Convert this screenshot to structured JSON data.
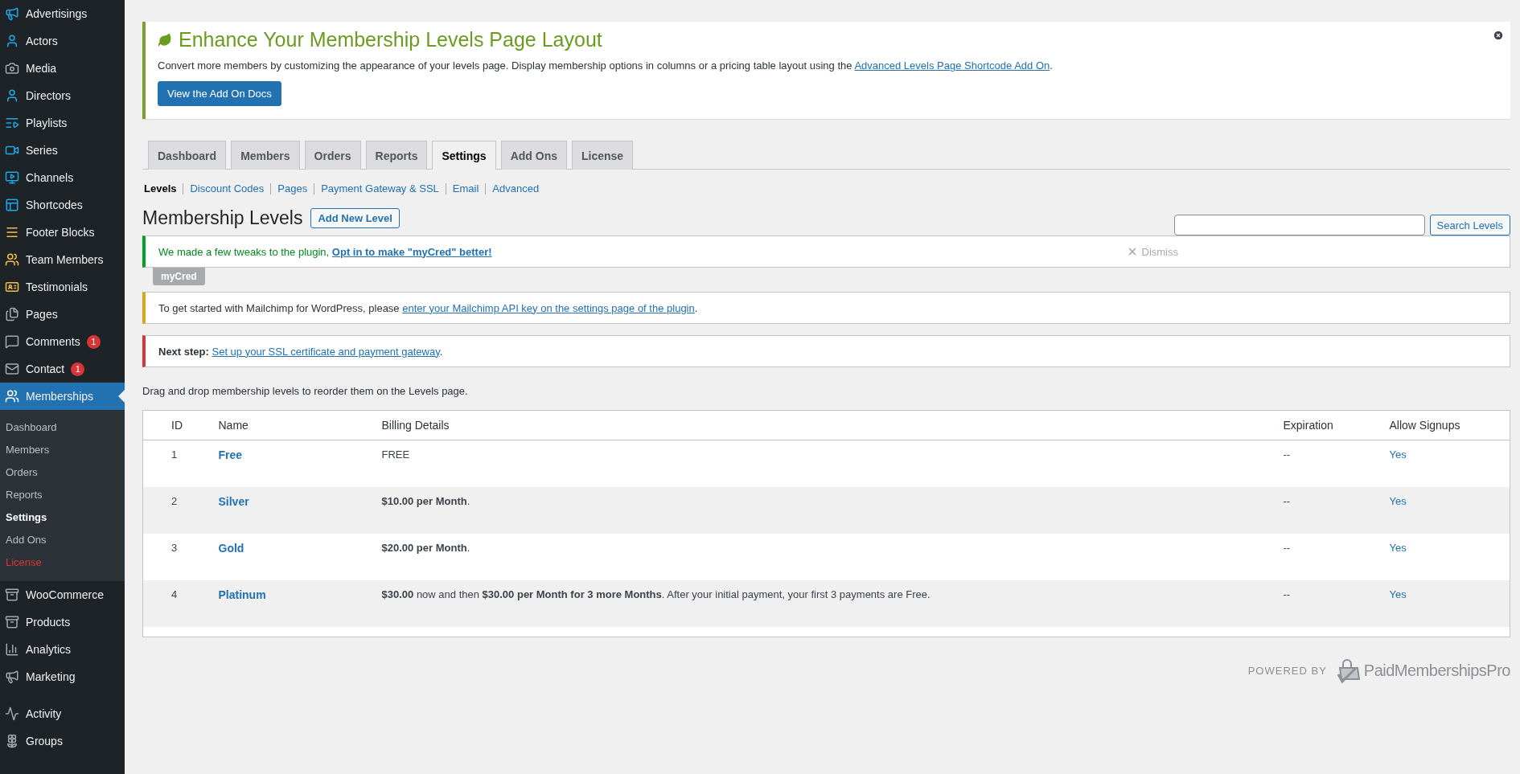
{
  "sidebar": {
    "sections": [
      {
        "items": [
          {
            "label": "Advertisings",
            "selected": false
          },
          {
            "label": "Actors",
            "selected": false
          },
          {
            "label": "Media",
            "selected": false
          },
          {
            "label": "Directors",
            "selected": false
          },
          {
            "label": "Playlists",
            "selected": false
          },
          {
            "label": "Series",
            "selected": false
          },
          {
            "label": "Channels",
            "selected": false
          },
          {
            "label": "Shortcodes",
            "selected": false
          },
          {
            "label": "Footer Blocks",
            "selected": false
          },
          {
            "label": "Team Members",
            "selected": false
          },
          {
            "label": "Testimonials",
            "selected": false
          },
          {
            "label": "Pages",
            "selected": false
          },
          {
            "label": "Comments",
            "selected": false,
            "badge": "1"
          },
          {
            "label": "Contact",
            "selected": false,
            "badge": "1"
          },
          {
            "label": "Memberships",
            "selected": true,
            "children": [
              {
                "label": "Dashboard",
                "selected": false,
                "kind": "item"
              },
              {
                "label": "Members",
                "selected": false,
                "kind": "item"
              },
              {
                "label": "Orders",
                "selected": false,
                "kind": "item"
              },
              {
                "label": "Reports",
                "selected": false,
                "kind": "item"
              },
              {
                "label": "Settings",
                "selected": true,
                "kind": "item"
              },
              {
                "label": "Add Ons",
                "selected": false,
                "kind": "item"
              },
              {
                "label": "License",
                "selected": false,
                "kind": "alert"
              }
            ]
          }
        ]
      },
      {
        "items": [
          {
            "label": "WooCommerce",
            "selected": false
          },
          {
            "label": "Products",
            "selected": false
          },
          {
            "label": "Analytics",
            "selected": false
          },
          {
            "label": "Marketing",
            "selected": false
          }
        ]
      },
      {
        "items": [
          {
            "label": "Activity",
            "selected": false
          },
          {
            "label": "Groups",
            "selected": false
          }
        ]
      }
    ]
  },
  "banner": {
    "title": "Enhance Your Membership Levels Page Layout",
    "text": "Convert more members by customizing the appearance of your levels page. Display membership options in columns or a pricing table layout using the",
    "link": "Advanced Levels Page Shortcode Add On",
    "after_link": ".",
    "button": "View the Add On Docs"
  },
  "tabs": [
    {
      "label": "Dashboard",
      "selected": false
    },
    {
      "label": "Members",
      "selected": false
    },
    {
      "label": "Orders",
      "selected": false
    },
    {
      "label": "Reports",
      "selected": false
    },
    {
      "label": "Settings",
      "selected": true
    },
    {
      "label": "Add Ons",
      "selected": false
    },
    {
      "label": "License",
      "selected": false
    }
  ],
  "subnav": [
    {
      "label": "Levels",
      "selected": true
    },
    {
      "label": "Discount Codes",
      "selected": false
    },
    {
      "label": "Pages",
      "selected": false
    },
    {
      "label": "Payment Gateway & SSL",
      "selected": false
    },
    {
      "label": "Email",
      "selected": false
    },
    {
      "label": "Advanced",
      "selected": false
    }
  ],
  "heading": {
    "title": "Membership Levels",
    "button": "Add New Level"
  },
  "search": {
    "button": "Search Levels"
  },
  "notices": [
    {
      "kind": "success",
      "text": "We made a few tweaks to the plugin,",
      "link": "Opt in to make \"myCred\" better!",
      "dismiss": "Dismiss",
      "tag": "myCred"
    },
    {
      "kind": "warning",
      "text": "To get started with Mailchimp for WordPress, please",
      "link": "enter your Mailchimp API key on the settings page of the plugin",
      "after_link": "."
    },
    {
      "kind": "error",
      "lead": "Next step:",
      "link": "Set up your SSL certificate and payment gateway",
      "after_link": "."
    }
  ],
  "hint": "Drag and drop membership levels to reorder them on the Levels page.",
  "table": {
    "columns": [
      "ID",
      "Name",
      "Billing Details",
      "Expiration",
      "Allow Signups"
    ],
    "rows": [
      {
        "id": "1",
        "name": "Free",
        "billing": "FREE",
        "expiration": "--",
        "allow_signups": "Yes"
      },
      {
        "id": "2",
        "name": "Silver",
        "billing": "**$10.00 per Month**.",
        "expiration": "--",
        "allow_signups": "Yes"
      },
      {
        "id": "3",
        "name": "Gold",
        "billing": "**$20.00 per Month**.",
        "expiration": "--",
        "allow_signups": "Yes"
      },
      {
        "id": "4",
        "name": "Platinum",
        "billing": "**$30.00** now and then **$30.00 per Month for 3 more Months**. After your initial payment, your first 3 payments are Free.",
        "expiration": "--",
        "allow_signups": "Yes"
      }
    ]
  },
  "footer": {
    "powered_by": "POWERED BY",
    "brand": "PaidMembershipsPro"
  }
}
